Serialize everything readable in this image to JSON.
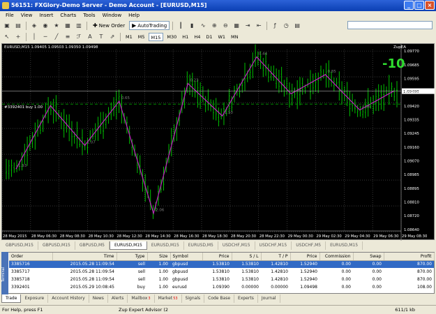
{
  "window": {
    "title": "56151: FXGlory-Demo Server - Demo Account - [EURUSD,M15]"
  },
  "menu": [
    "File",
    "View",
    "Insert",
    "Charts",
    "Tools",
    "Window",
    "Help"
  ],
  "toolbar": {
    "new_order": "New Order",
    "autotrading": "AutoTrading"
  },
  "periods": [
    "M1",
    "M5",
    "M15",
    "M30",
    "H1",
    "H4",
    "D1",
    "W1",
    "MN"
  ],
  "active_period": "M15",
  "chart": {
    "header": "EURUSD,M15  1.09405 1.09503 1.09350 1.09498",
    "ea_label": "ZupEA",
    "big_label": "-10",
    "order_line_label": "#3392401 buy 1.00",
    "current_price": "1.09498",
    "price_ticks": [
      "1.09770",
      "1.09595",
      "1.09420",
      "1.09245",
      "1.09070",
      "1.08895",
      "1.08720",
      "1.08545"
    ],
    "price_tick_values": [
      1.0977,
      1.09595,
      1.0942,
      1.09245,
      1.0907,
      1.08895,
      1.0872,
      1.08545
    ],
    "price_axis_labels": [
      "1.09770",
      "1.09685",
      "1.09595",
      "1.09510",
      "1.09420",
      "1.09335",
      "1.09245",
      "1.09160",
      "1.09070",
      "1.08985",
      "1.08895",
      "1.08810",
      "1.08720",
      "1.08640"
    ],
    "time_ticks": [
      "28 May 2015",
      "28 May 06:30",
      "28 May 08:30",
      "28 May 10:30",
      "28 May 12:30",
      "28 May 14:30",
      "28 May 16:30",
      "28 May 18:30",
      "28 May 20:30",
      "28 May 22:30",
      "29 May 00:30",
      "29 May 02:30",
      "29 May 04:30",
      "29 May 06:30",
      "29 May 08:30"
    ],
    "zigzag_labels": [
      "1.93",
      "1.07",
      "0.65",
      "2.06",
      "0.23",
      "1.10",
      "0.44",
      "2.56",
      "0.85",
      "2.56"
    ],
    "price_min": 1.0855,
    "price_max": 1.0978,
    "zigzag_prices": [
      1.0897,
      1.094,
      1.0913,
      1.0943,
      1.0867,
      1.0955,
      1.0933,
      1.0973,
      1.0948,
      1.0961,
      1.0937,
      1.095
    ],
    "order_line_price": 1.0941,
    "current_line_price": 1.09498,
    "colors": {
      "candle": "#00c000",
      "zigzag": "#c020c0",
      "grid": "#5a5a5a",
      "bg": "#000000"
    }
  },
  "chart_tabs": [
    "GBPUSD,M15",
    "GBPUSD,M15",
    "GBPUSD,M5",
    "EURUSD,M15",
    "EURUSD,M15",
    "EURUSD,M5",
    "USDCHF,M15",
    "USDCHF,M15",
    "USDCHF,M5",
    "EURUSD,M15"
  ],
  "active_chart_tab": 3,
  "terminal": {
    "columns": [
      "Order",
      "Time",
      "Type",
      "Size",
      "Symbol",
      "Price",
      "S / L",
      "T / P",
      "Price",
      "Commission",
      "Swap",
      "Profit"
    ],
    "rows": [
      {
        "order": "3385716",
        "time": "2015.05.28 11:09:54",
        "type": "sell",
        "size": "1.00",
        "symbol": "gbpusd",
        "price": "1.53810",
        "sl": "1.53810",
        "tp": "1.42810",
        "cur": "1.52940",
        "commission": "0.00",
        "swap": "0.00",
        "profit": "870.00",
        "selected": true
      },
      {
        "order": "3385717",
        "time": "2015.05.28 11:09:54",
        "type": "sell",
        "size": "1.00",
        "symbol": "gbpusd",
        "price": "1.53810",
        "sl": "1.53810",
        "tp": "1.42810",
        "cur": "1.52940",
        "commission": "0.00",
        "swap": "0.00",
        "profit": "870.00",
        "selected": false
      },
      {
        "order": "3385718",
        "time": "2015.05.28 11:09:54",
        "type": "sell",
        "size": "1.00",
        "symbol": "gbpusd",
        "price": "1.53810",
        "sl": "1.53810",
        "tp": "1.42810",
        "cur": "1.52940",
        "commission": "0.00",
        "swap": "0.00",
        "profit": "870.00",
        "selected": false
      },
      {
        "order": "3392401",
        "time": "2015.05.29 10:08:45",
        "type": "buy",
        "size": "1.00",
        "symbol": "eurusd",
        "price": "1.09390",
        "sl": "0.00000",
        "tp": "0.00000",
        "cur": "1.09498",
        "commission": "0.00",
        "swap": "0.00",
        "profit": "108.00",
        "selected": false
      }
    ],
    "side_label": "Terminal"
  },
  "terminal_tabs": [
    {
      "label": "Trade",
      "badge": ""
    },
    {
      "label": "Exposure",
      "badge": ""
    },
    {
      "label": "Account History",
      "badge": ""
    },
    {
      "label": "News",
      "badge": ""
    },
    {
      "label": "Alerts",
      "badge": ""
    },
    {
      "label": "Mailbox",
      "badge": "3"
    },
    {
      "label": "Market",
      "badge": "53"
    },
    {
      "label": "Signals",
      "badge": ""
    },
    {
      "label": "Code Base",
      "badge": ""
    },
    {
      "label": "Experts",
      "badge": ""
    },
    {
      "label": "Journal",
      "badge": ""
    }
  ],
  "status": {
    "left": "For Help, press F1",
    "mid": "Zup Expert Advisor (2",
    "right": "611/1 kb"
  }
}
